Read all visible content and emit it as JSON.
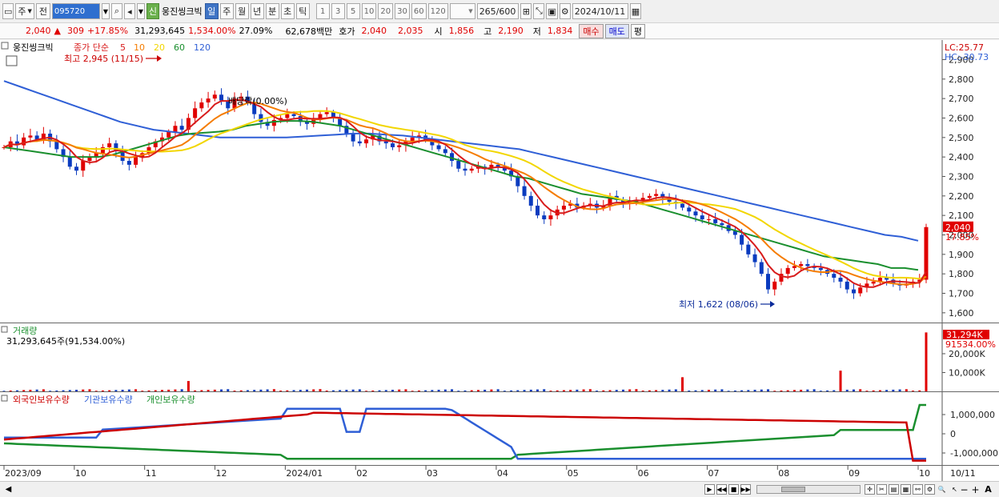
{
  "toolbar": {
    "market_label": "주",
    "prev_label": "전",
    "stock_code": "095720",
    "new_badge": "신",
    "stock_name": "웅진씽크빅",
    "periods": [
      {
        "label": "일",
        "active": true
      },
      {
        "label": "주",
        "active": false
      },
      {
        "label": "월",
        "active": false
      },
      {
        "label": "년",
        "active": false
      },
      {
        "label": "분",
        "active": false
      },
      {
        "label": "초",
        "active": false
      },
      {
        "label": "틱",
        "active": false
      }
    ],
    "intervals": [
      "1",
      "3",
      "5",
      "10",
      "20",
      "30",
      "60",
      "120"
    ],
    "display_count": "265",
    "total_count": "/600",
    "date": "2024/10/11"
  },
  "quote": {
    "price": "2,040",
    "change": "309",
    "change_rate": "+17.85%",
    "volume": "31,293,645",
    "volume_rate": "1,534.00%",
    "turnover": "27.09%",
    "amount": "62,678백만",
    "ask_label": "호가",
    "ask": "2,040",
    "bid": "2,035",
    "open_label": "시",
    "open": "1,856",
    "high_label": "고",
    "high": "2,190",
    "low_label": "저",
    "low": "1,834",
    "buy_label": "매수",
    "sell_label": "매도",
    "eval_label": "평"
  },
  "price_panel": {
    "stock_name": "웅진씽크빅",
    "legend_prefix": "종가 단순",
    "ma_labels": [
      {
        "label": "5",
        "color": "#d81b1b"
      },
      {
        "label": "10",
        "color": "#f57c00"
      },
      {
        "label": "20",
        "color": "#f2d600"
      },
      {
        "label": "60",
        "color": "#1a8f2e"
      },
      {
        "label": "120",
        "color": "#2f5fd6"
      }
    ],
    "high_annotation": "최고 2,945 (11/15)",
    "low_annotation": "최저 1,622 (08/06)",
    "dividend_annotation": "배당락(0.00%)",
    "lc_label": "LC:25.77",
    "hc_label": "HC:-30.73",
    "price_tag": "2,040",
    "rate_tag": "17.85%",
    "y_ticks": [
      "2,900",
      "2,800",
      "2,700",
      "2,600",
      "2,500",
      "2,400",
      "2,300",
      "2,200",
      "2,100",
      "2,000",
      "1,900",
      "1,800",
      "1,700",
      "1,600"
    ]
  },
  "volume_panel": {
    "title": "거래량",
    "value_text": "31,293,645주(91,534.00%)",
    "tag_value": "31,294K",
    "tag_rate": "91534.00%",
    "y_ticks": [
      "20,000K",
      "10,000K"
    ]
  },
  "holding_panel": {
    "legend": [
      {
        "label": "외국인보유수량",
        "color": "#cc0000"
      },
      {
        "label": "기관보유수량",
        "color": "#2f5fd6"
      },
      {
        "label": "개인보유수량",
        "color": "#1a8f2e"
      }
    ],
    "y_ticks": [
      "1,000,000",
      "0",
      "-1,000,000"
    ]
  },
  "x_axis": {
    "labels": [
      "2023/09",
      "10",
      "11",
      "12",
      "2024/01",
      "02",
      "03",
      "04",
      "05",
      "06",
      "07",
      "08",
      "09",
      "10"
    ],
    "right_label": "10/11"
  },
  "chart_data": {
    "type": "line",
    "price_axis_range": [
      1550,
      2980
    ],
    "close": [
      2450,
      2480,
      2460,
      2500,
      2510,
      2490,
      2520,
      2480,
      2440,
      2400,
      2350,
      2330,
      2380,
      2400,
      2420,
      2450,
      2470,
      2430,
      2380,
      2360,
      2400,
      2420,
      2450,
      2480,
      2500,
      2530,
      2560,
      2540,
      2600,
      2650,
      2680,
      2700,
      2720,
      2690,
      2650,
      2700,
      2710,
      2680,
      2620,
      2580,
      2560,
      2590,
      2600,
      2620,
      2610,
      2580,
      2570,
      2600,
      2620,
      2630,
      2600,
      2560,
      2520,
      2480,
      2470,
      2490,
      2510,
      2480,
      2470,
      2450,
      2460,
      2480,
      2500,
      2510,
      2490,
      2460,
      2440,
      2420,
      2380,
      2340,
      2330,
      2340,
      2350,
      2340,
      2360,
      2350,
      2330,
      2300,
      2250,
      2200,
      2150,
      2100,
      2080,
      2100,
      2130,
      2150,
      2160,
      2140,
      2150,
      2160,
      2140,
      2150,
      2200,
      2180,
      2160,
      2170,
      2180,
      2190,
      2200,
      2210,
      2190,
      2170,
      2160,
      2140,
      2120,
      2100,
      2080,
      2080,
      2060,
      2050,
      2020,
      2000,
      1950,
      1900,
      1860,
      1800,
      1720,
      1760,
      1800,
      1830,
      1840,
      1850,
      1840,
      1830,
      1820,
      1800,
      1780,
      1760,
      1720,
      1700,
      1730,
      1750,
      1760,
      1780,
      1770,
      1750,
      1740,
      1750,
      1760,
      1770,
      2040
    ],
    "ma60": [
      2450,
      2440,
      2430,
      2420,
      2410,
      2400,
      2400,
      2400,
      2410,
      2430,
      2450,
      2470,
      2490,
      2510,
      2520,
      2525,
      2530,
      2540,
      2560,
      2570,
      2580,
      2585,
      2585,
      2580,
      2570,
      2560,
      2540,
      2520,
      2500,
      2480,
      2460,
      2440,
      2420,
      2400,
      2380,
      2360,
      2340,
      2320,
      2300,
      2290,
      2270,
      2250,
      2230,
      2210,
      2200,
      2190,
      2180,
      2170,
      2150,
      2130,
      2110,
      2090,
      2070,
      2050,
      2030,
      2010,
      1990,
      1970,
      1950,
      1930,
      1910,
      1890,
      1880,
      1870,
      1860,
      1850,
      1830,
      1830,
      1820
    ],
    "ma120": [
      2790,
      2760,
      2730,
      2700,
      2670,
      2640,
      2610,
      2580,
      2560,
      2540,
      2530,
      2520,
      2510,
      2500,
      2500,
      2500,
      2500,
      2500,
      2505,
      2510,
      2515,
      2520,
      2520,
      2515,
      2510,
      2500,
      2490,
      2480,
      2470,
      2460,
      2450,
      2440,
      2420,
      2400,
      2380,
      2360,
      2340,
      2320,
      2300,
      2280,
      2260,
      2240,
      2220,
      2200,
      2180,
      2160,
      2140,
      2120,
      2100,
      2080,
      2060,
      2040,
      2020,
      2000,
      1990,
      1970
    ],
    "volume_spikes_k": [
      {
        "x": "11/15",
        "value": 5500
      },
      {
        "x": "05",
        "value": 7500
      },
      {
        "x": "09",
        "value": 11000
      },
      {
        "x": "10/11",
        "value": 31294
      }
    ],
    "volume_axis_range": [
      0,
      34000
    ]
  }
}
